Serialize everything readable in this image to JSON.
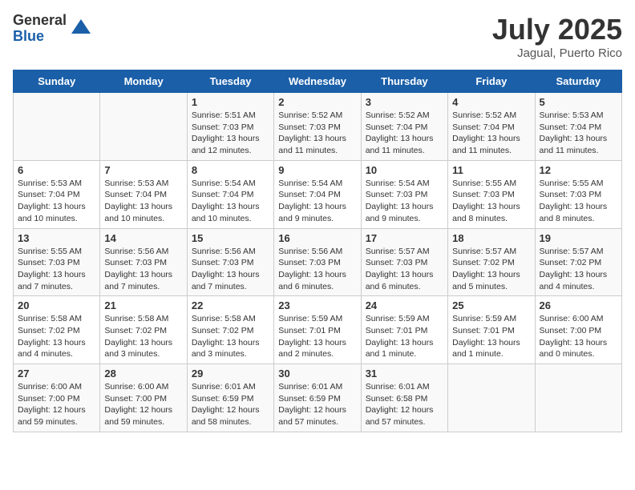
{
  "logo": {
    "general": "General",
    "blue": "Blue"
  },
  "title": {
    "month_year": "July 2025",
    "location": "Jagual, Puerto Rico"
  },
  "weekdays": [
    "Sunday",
    "Monday",
    "Tuesday",
    "Wednesday",
    "Thursday",
    "Friday",
    "Saturday"
  ],
  "weeks": [
    [
      {
        "day": "",
        "info": ""
      },
      {
        "day": "",
        "info": ""
      },
      {
        "day": "1",
        "info": "Sunrise: 5:51 AM\nSunset: 7:03 PM\nDaylight: 13 hours and 12 minutes."
      },
      {
        "day": "2",
        "info": "Sunrise: 5:52 AM\nSunset: 7:03 PM\nDaylight: 13 hours and 11 minutes."
      },
      {
        "day": "3",
        "info": "Sunrise: 5:52 AM\nSunset: 7:04 PM\nDaylight: 13 hours and 11 minutes."
      },
      {
        "day": "4",
        "info": "Sunrise: 5:52 AM\nSunset: 7:04 PM\nDaylight: 13 hours and 11 minutes."
      },
      {
        "day": "5",
        "info": "Sunrise: 5:53 AM\nSunset: 7:04 PM\nDaylight: 13 hours and 11 minutes."
      }
    ],
    [
      {
        "day": "6",
        "info": "Sunrise: 5:53 AM\nSunset: 7:04 PM\nDaylight: 13 hours and 10 minutes."
      },
      {
        "day": "7",
        "info": "Sunrise: 5:53 AM\nSunset: 7:04 PM\nDaylight: 13 hours and 10 minutes."
      },
      {
        "day": "8",
        "info": "Sunrise: 5:54 AM\nSunset: 7:04 PM\nDaylight: 13 hours and 10 minutes."
      },
      {
        "day": "9",
        "info": "Sunrise: 5:54 AM\nSunset: 7:04 PM\nDaylight: 13 hours and 9 minutes."
      },
      {
        "day": "10",
        "info": "Sunrise: 5:54 AM\nSunset: 7:03 PM\nDaylight: 13 hours and 9 minutes."
      },
      {
        "day": "11",
        "info": "Sunrise: 5:55 AM\nSunset: 7:03 PM\nDaylight: 13 hours and 8 minutes."
      },
      {
        "day": "12",
        "info": "Sunrise: 5:55 AM\nSunset: 7:03 PM\nDaylight: 13 hours and 8 minutes."
      }
    ],
    [
      {
        "day": "13",
        "info": "Sunrise: 5:55 AM\nSunset: 7:03 PM\nDaylight: 13 hours and 7 minutes."
      },
      {
        "day": "14",
        "info": "Sunrise: 5:56 AM\nSunset: 7:03 PM\nDaylight: 13 hours and 7 minutes."
      },
      {
        "day": "15",
        "info": "Sunrise: 5:56 AM\nSunset: 7:03 PM\nDaylight: 13 hours and 7 minutes."
      },
      {
        "day": "16",
        "info": "Sunrise: 5:56 AM\nSunset: 7:03 PM\nDaylight: 13 hours and 6 minutes."
      },
      {
        "day": "17",
        "info": "Sunrise: 5:57 AM\nSunset: 7:03 PM\nDaylight: 13 hours and 6 minutes."
      },
      {
        "day": "18",
        "info": "Sunrise: 5:57 AM\nSunset: 7:02 PM\nDaylight: 13 hours and 5 minutes."
      },
      {
        "day": "19",
        "info": "Sunrise: 5:57 AM\nSunset: 7:02 PM\nDaylight: 13 hours and 4 minutes."
      }
    ],
    [
      {
        "day": "20",
        "info": "Sunrise: 5:58 AM\nSunset: 7:02 PM\nDaylight: 13 hours and 4 minutes."
      },
      {
        "day": "21",
        "info": "Sunrise: 5:58 AM\nSunset: 7:02 PM\nDaylight: 13 hours and 3 minutes."
      },
      {
        "day": "22",
        "info": "Sunrise: 5:58 AM\nSunset: 7:02 PM\nDaylight: 13 hours and 3 minutes."
      },
      {
        "day": "23",
        "info": "Sunrise: 5:59 AM\nSunset: 7:01 PM\nDaylight: 13 hours and 2 minutes."
      },
      {
        "day": "24",
        "info": "Sunrise: 5:59 AM\nSunset: 7:01 PM\nDaylight: 13 hours and 1 minute."
      },
      {
        "day": "25",
        "info": "Sunrise: 5:59 AM\nSunset: 7:01 PM\nDaylight: 13 hours and 1 minute."
      },
      {
        "day": "26",
        "info": "Sunrise: 6:00 AM\nSunset: 7:00 PM\nDaylight: 13 hours and 0 minutes."
      }
    ],
    [
      {
        "day": "27",
        "info": "Sunrise: 6:00 AM\nSunset: 7:00 PM\nDaylight: 12 hours and 59 minutes."
      },
      {
        "day": "28",
        "info": "Sunrise: 6:00 AM\nSunset: 7:00 PM\nDaylight: 12 hours and 59 minutes."
      },
      {
        "day": "29",
        "info": "Sunrise: 6:01 AM\nSunset: 6:59 PM\nDaylight: 12 hours and 58 minutes."
      },
      {
        "day": "30",
        "info": "Sunrise: 6:01 AM\nSunset: 6:59 PM\nDaylight: 12 hours and 57 minutes."
      },
      {
        "day": "31",
        "info": "Sunrise: 6:01 AM\nSunset: 6:58 PM\nDaylight: 12 hours and 57 minutes."
      },
      {
        "day": "",
        "info": ""
      },
      {
        "day": "",
        "info": ""
      }
    ]
  ]
}
